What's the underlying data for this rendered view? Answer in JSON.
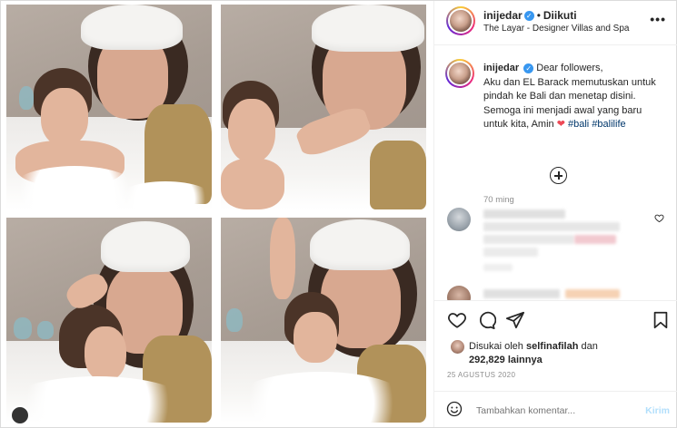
{
  "post": {
    "username": "inijedar",
    "follow_status": "Diikuti",
    "location": "The Layar - Designer Villas and Spa",
    "more_label": "•••",
    "verified_mark": "✓"
  },
  "caption": {
    "username": "inijedar",
    "text_line1": "Dear followers,",
    "text_line2": "Aku dan EL Barack memutuskan untuk pindah ke Bali dan menetap disini. Semoga ini menjadi awal yang baru untuk kita, Amin",
    "heart": "❤",
    "hashtag1": "#bali",
    "hashtag2": "#balilife",
    "time": "70 ming"
  },
  "likes": {
    "prefix": "Disukai oleh",
    "liker": "selfinafilah",
    "connector": "dan",
    "count": "292,829",
    "suffix": "lainnya"
  },
  "date": "25 AGUSTUS 2020",
  "add_comment": {
    "placeholder": "Tambahkan komentar...",
    "send_label": "Kirim"
  },
  "icons": {
    "like": "heart-outline",
    "comment": "comment-bubble",
    "share": "paper-plane",
    "save": "bookmark",
    "emoji": "smiley",
    "load_more": "plus-circle"
  },
  "colors": {
    "verified": "#3897f0",
    "hashtag": "#00376b",
    "heart": "#ed4956",
    "send_disabled": "#b2dffc"
  }
}
